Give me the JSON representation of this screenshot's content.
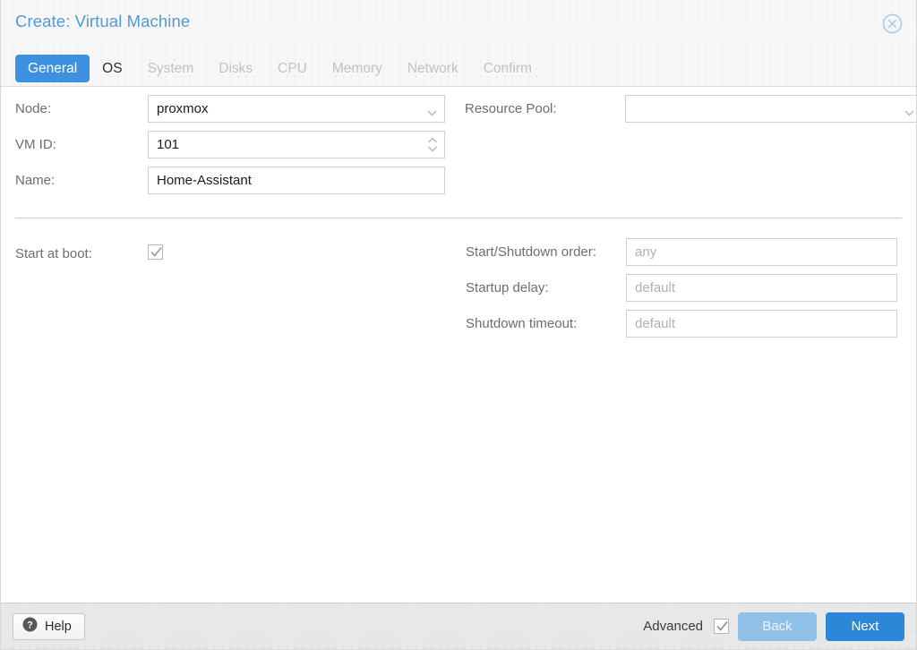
{
  "dialog": {
    "title": "Create: Virtual Machine",
    "close_icon": "close-circle-icon"
  },
  "tabs": [
    {
      "label": "General",
      "state": "active"
    },
    {
      "label": "OS",
      "state": "enabled"
    },
    {
      "label": "System",
      "state": "disabled"
    },
    {
      "label": "Disks",
      "state": "disabled"
    },
    {
      "label": "CPU",
      "state": "disabled"
    },
    {
      "label": "Memory",
      "state": "disabled"
    },
    {
      "label": "Network",
      "state": "disabled"
    },
    {
      "label": "Confirm",
      "state": "disabled"
    }
  ],
  "form": {
    "node": {
      "label": "Node:",
      "value": "proxmox"
    },
    "vmid": {
      "label": "VM ID:",
      "value": "101"
    },
    "name": {
      "label": "Name:",
      "value": "Home-Assistant"
    },
    "resource_pool": {
      "label": "Resource Pool:",
      "value": ""
    },
    "start_at_boot": {
      "label": "Start at boot:",
      "checked": true
    },
    "start_shutdown_order": {
      "label": "Start/Shutdown order:",
      "placeholder": "any"
    },
    "startup_delay": {
      "label": "Startup delay:",
      "placeholder": "default"
    },
    "shutdown_timeout": {
      "label": "Shutdown timeout:",
      "placeholder": "default"
    }
  },
  "footer": {
    "help_label": "Help",
    "help_icon": "question-circle-icon",
    "advanced_label": "Advanced",
    "advanced_checked": true,
    "back_label": "Back",
    "next_label": "Next"
  },
  "colors": {
    "accent_blue": "#2d87d8",
    "tab_active_blue": "#3c92e0",
    "title_blue": "#4e9bd6",
    "back_disabled_blue": "#8fc0e8"
  }
}
